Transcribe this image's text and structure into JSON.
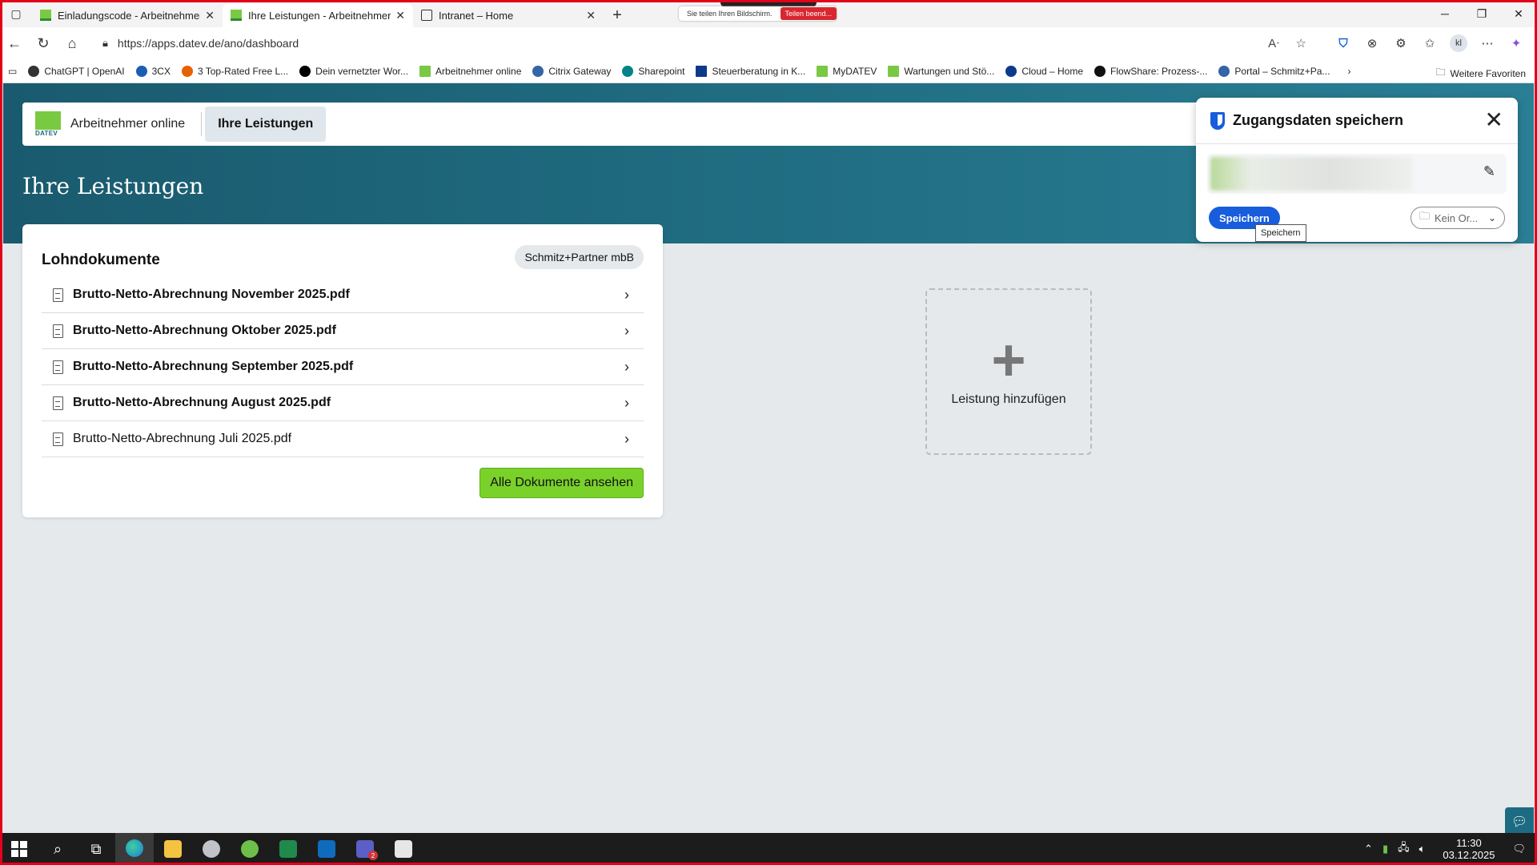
{
  "browser": {
    "tabs": [
      {
        "label": "Einladungscode - Arbeitnehmer o",
        "active": false,
        "favicon": "datev-icon"
      },
      {
        "label": "Ihre Leistungen - Arbeitnehmer o",
        "active": true,
        "favicon": "datev-icon"
      },
      {
        "label": "Intranet – Home",
        "active": false,
        "favicon": "intranet-icon"
      }
    ],
    "new_tab": "+",
    "screen_share": {
      "message": "Sie teilen Ihren Bildschirm.",
      "stop_label": "Teilen beend..."
    },
    "url": "https://apps.datev.de/ano/dashboard",
    "profile_initials": "kl",
    "bitwarden_badge": "1",
    "bookmarks": [
      {
        "label": "ChatGPT | OpenAI",
        "icon": "openai-icon",
        "color": "#333333"
      },
      {
        "label": "3CX",
        "icon": "3cx-icon",
        "color": "#1a5fb4"
      },
      {
        "label": "3 Top-Rated Free L...",
        "icon": "send-icon",
        "color": "#e66100"
      },
      {
        "label": "Dein vernetzter Wor...",
        "icon": "notion-icon",
        "color": "#000000"
      },
      {
        "label": "Arbeitnehmer online",
        "icon": "datev-icon",
        "color": "#7ac943"
      },
      {
        "label": "Citrix Gateway",
        "icon": "citrix-icon",
        "color": "#3465a4"
      },
      {
        "label": "Sharepoint",
        "icon": "sharepoint-icon",
        "color": "#038387"
      },
      {
        "label": "Steuerberatung in K...",
        "icon": "blue-square-icon",
        "color": "#0b3a8a"
      },
      {
        "label": "MyDATEV",
        "icon": "datev-icon",
        "color": "#7ac943"
      },
      {
        "label": "Wartungen und Stö...",
        "icon": "datev-icon",
        "color": "#7ac943"
      },
      {
        "label": "Cloud – Home",
        "icon": "cloud-icon",
        "color": "#0b3a8a"
      },
      {
        "label": "FlowShare: Prozess-...",
        "icon": "flowshare-icon",
        "color": "#111111"
      },
      {
        "label": "Portal – Schmitz+Pa...",
        "icon": "portal-icon",
        "color": "#3465a4"
      }
    ],
    "other_favorites": "Weitere Favoriten"
  },
  "app": {
    "logo_text": "DATEV",
    "name": "Arbeitnehmer online",
    "nav_active": "Ihre Leistungen",
    "page_title": "Ihre Leistungen"
  },
  "card": {
    "title": "Lohndokumente",
    "company": "Schmitz+Partner mbB",
    "documents": [
      {
        "name": "Brutto-Netto-Abrechnung November 2025.pdf",
        "unread": true
      },
      {
        "name": "Brutto-Netto-Abrechnung Oktober 2025.pdf",
        "unread": true
      },
      {
        "name": "Brutto-Netto-Abrechnung September 2025.pdf",
        "unread": true
      },
      {
        "name": "Brutto-Netto-Abrechnung August 2025.pdf",
        "unread": true
      },
      {
        "name": "Brutto-Netto-Abrechnung Juli 2025.pdf",
        "unread": false
      }
    ],
    "all_button": "Alle Dokumente ansehen"
  },
  "add_tile": {
    "label": "Leistung hinzufügen"
  },
  "bitwarden": {
    "title": "Zugangsdaten speichern",
    "save_label": "Speichern",
    "folder_label": "Kein Or...",
    "tooltip": "Speichern"
  },
  "taskbar": {
    "teams_badge": "2",
    "time": "11:30",
    "date": "03.12.2025"
  },
  "colors": {
    "hero": "#206d82",
    "accent_green": "#7ad12a",
    "bitwarden_blue": "#175ddc",
    "frame_red": "#e3001b"
  }
}
